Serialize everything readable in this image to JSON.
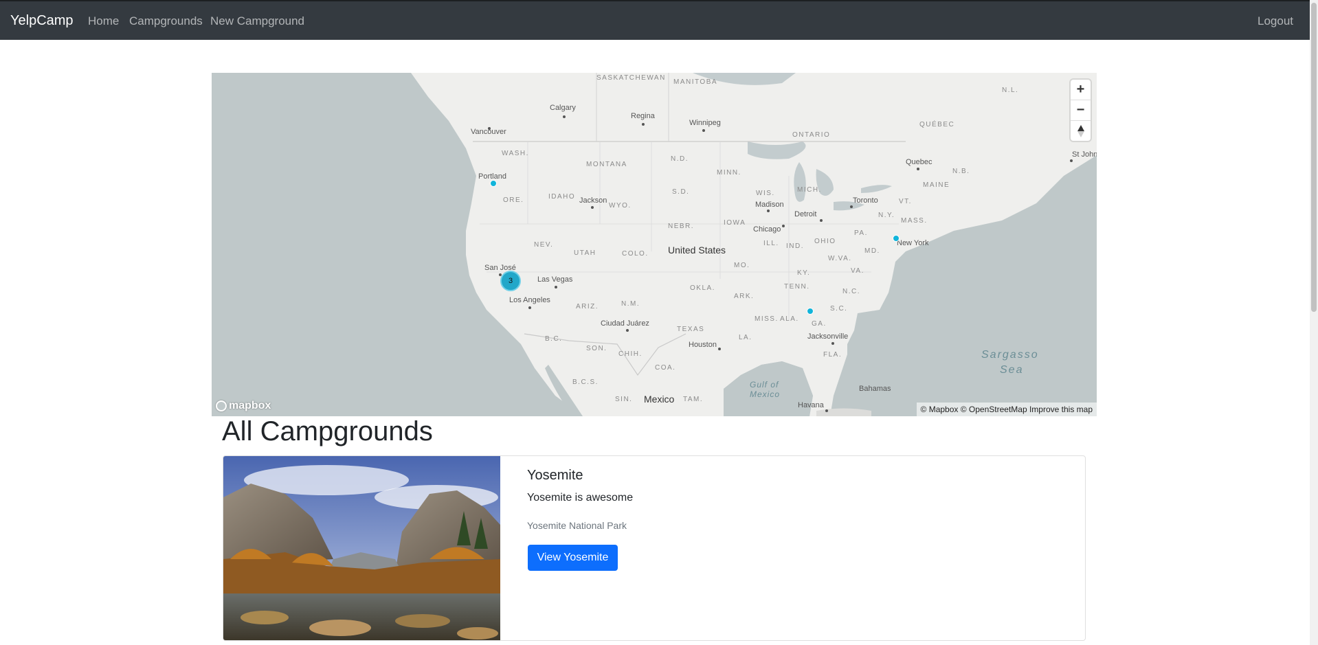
{
  "navbar": {
    "brand": "YelpCamp",
    "links": [
      "Home",
      "Campgrounds",
      "New Campground"
    ],
    "logout": "Logout"
  },
  "map": {
    "state_labels": [
      "SASKATCHEWAN",
      "MANITOBA",
      "WASH.",
      "MONTANA",
      "N.D.",
      "MINN.",
      "ONTARIO",
      "QUÉBEC",
      "N.L.",
      "ORE.",
      "IDAHO",
      "WYO.",
      "S.D.",
      "WIS.",
      "MICH.",
      "MAINE",
      "N.B.",
      "VT.",
      "N.Y.",
      "MASS.",
      "NEBR.",
      "IOWA",
      "PA.",
      "NEV.",
      "UTAH",
      "COLO.",
      "ILL.",
      "IND.",
      "OHIO",
      "MD.",
      "W.VA.",
      "VA.",
      "MO.",
      "KY.",
      "OKLA.",
      "TENN.",
      "N.C.",
      "ARIZ.",
      "N.M.",
      "ARK.",
      "S.C.",
      "MISS.",
      "ALA.",
      "GA.",
      "TEXAS",
      "LA.",
      "FLA.",
      "B.C.",
      "SON.",
      "CHIH.",
      "COA.",
      "B.C.S.",
      "SIN.",
      "TAM."
    ],
    "city_labels": [
      "Calgary",
      "Regina",
      "Winnipeg",
      "Vancouver",
      "Portland",
      "Jackson",
      "Madison",
      "Detroit",
      "Toronto",
      "Quebec",
      "St John",
      "Chicago",
      "New York",
      "San José",
      "Las Vegas",
      "Los Angeles",
      "Ciudad Juárez",
      "Houston",
      "Jacksonville",
      "Havana",
      "Bahamas"
    ],
    "country_labels": [
      "United States",
      "Mexico"
    ],
    "water_labels": [
      "Sargasso",
      "Sea",
      "Gulf of",
      "Mexico"
    ],
    "cluster_count": "3",
    "controls": {
      "zoom_in": "+",
      "zoom_out": "−"
    },
    "logo": "mapbox",
    "attribution": "© Mapbox © OpenStreetMap Improve this map"
  },
  "page": {
    "title": "All Campgrounds"
  },
  "campgrounds": [
    {
      "title": "Yosemite",
      "description": "Yosemite is awesome",
      "location": "Yosemite National Park",
      "button": "View Yosemite"
    }
  ],
  "icons": {
    "zoom_in": "plus-icon",
    "zoom_out": "minus-icon",
    "compass": "compass-icon"
  },
  "colors": {
    "navbar": "#343a40",
    "primary_button": "#0d6efd",
    "marker": "#11b4da",
    "cluster": "#22a7c9",
    "ocean": "#bfc8c9",
    "land": "#efefed"
  }
}
